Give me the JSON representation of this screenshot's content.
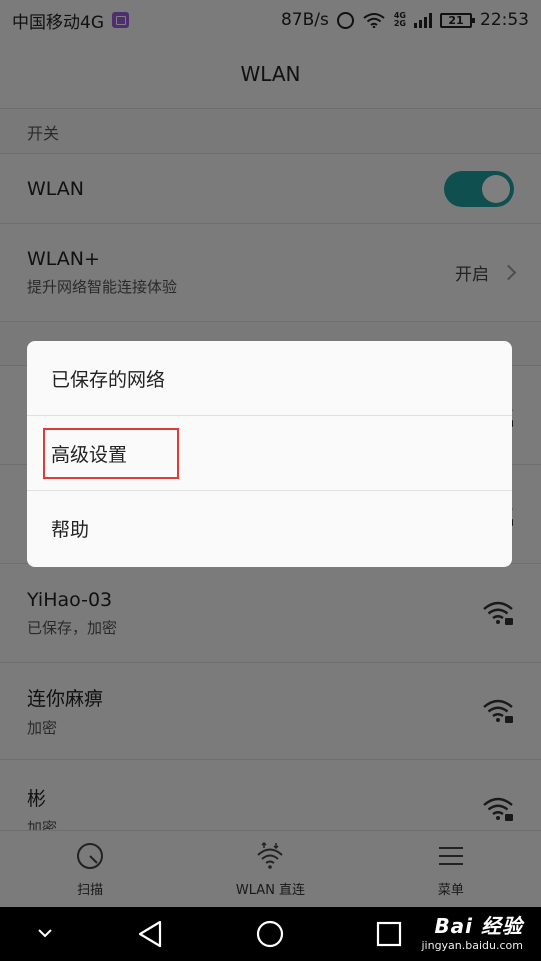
{
  "status_bar": {
    "carrier": "中国移动4G",
    "speed": "87B/s",
    "net_top": "4G",
    "net_bottom": "2G",
    "battery": "21",
    "time": "22:53"
  },
  "app_bar": {
    "title": "WLAN"
  },
  "switch_section": {
    "header": "开关"
  },
  "wlan_row": {
    "title": "WLAN",
    "enabled": true
  },
  "wlan_plus_row": {
    "title": "WLAN+",
    "subtitle": "提升网络智能连接体验",
    "status": "开启"
  },
  "networks": [
    {
      "ssid": "YiHao-03",
      "status": "已保存，加密"
    },
    {
      "ssid": "连你麻痹",
      "status": "加密"
    },
    {
      "ssid": "彬",
      "status": "加密"
    }
  ],
  "tab_bar": {
    "scan_label": "扫描",
    "direct_label": "WLAN 直连",
    "menu_label": "菜单"
  },
  "popup_menu": {
    "items": [
      {
        "label": "已保存的网络"
      },
      {
        "label": "高级设置",
        "highlighted": true
      },
      {
        "label": "帮助"
      }
    ]
  },
  "watermark": {
    "brand": "Bai 经验",
    "url": "jingyan.baidu.com"
  },
  "colors": {
    "accent": "#1f9e9e",
    "highlight_border": "#e53935"
  }
}
